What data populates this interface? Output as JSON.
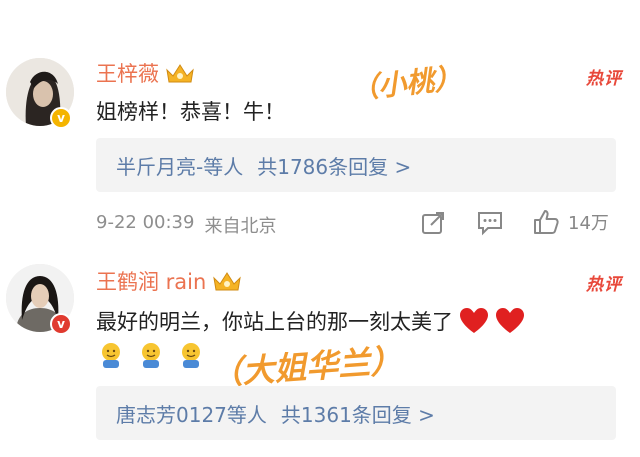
{
  "comments": [
    {
      "username": "王梓薇",
      "text": "姐榜样！恭喜！牛！",
      "hot_label": "热评",
      "reply_preview": "半斤月亮-等人",
      "reply_count": "共1786条回复 >",
      "date": "9-22 00:39",
      "source": "来自北京",
      "like_count": "14万",
      "annotation": "（小桃）"
    },
    {
      "username": "王鹤润 rain",
      "text": "最好的明兰，你站上台的那一刻太美了",
      "hot_label": "热评",
      "reply_preview": "唐志芳0127等人",
      "reply_count": "共1361条回复 >",
      "annotation": "（大姐华兰）"
    }
  ],
  "colors": {
    "username": "#eb7350",
    "link": "#5d7ca8",
    "hot": "#e8483a",
    "annotation": "#f19a2e"
  },
  "icons": [
    "crown-badge-icon",
    "share-icon",
    "comment-icon",
    "like-icon",
    "heart-emoji-icon",
    "hug-emoji-icon"
  ]
}
